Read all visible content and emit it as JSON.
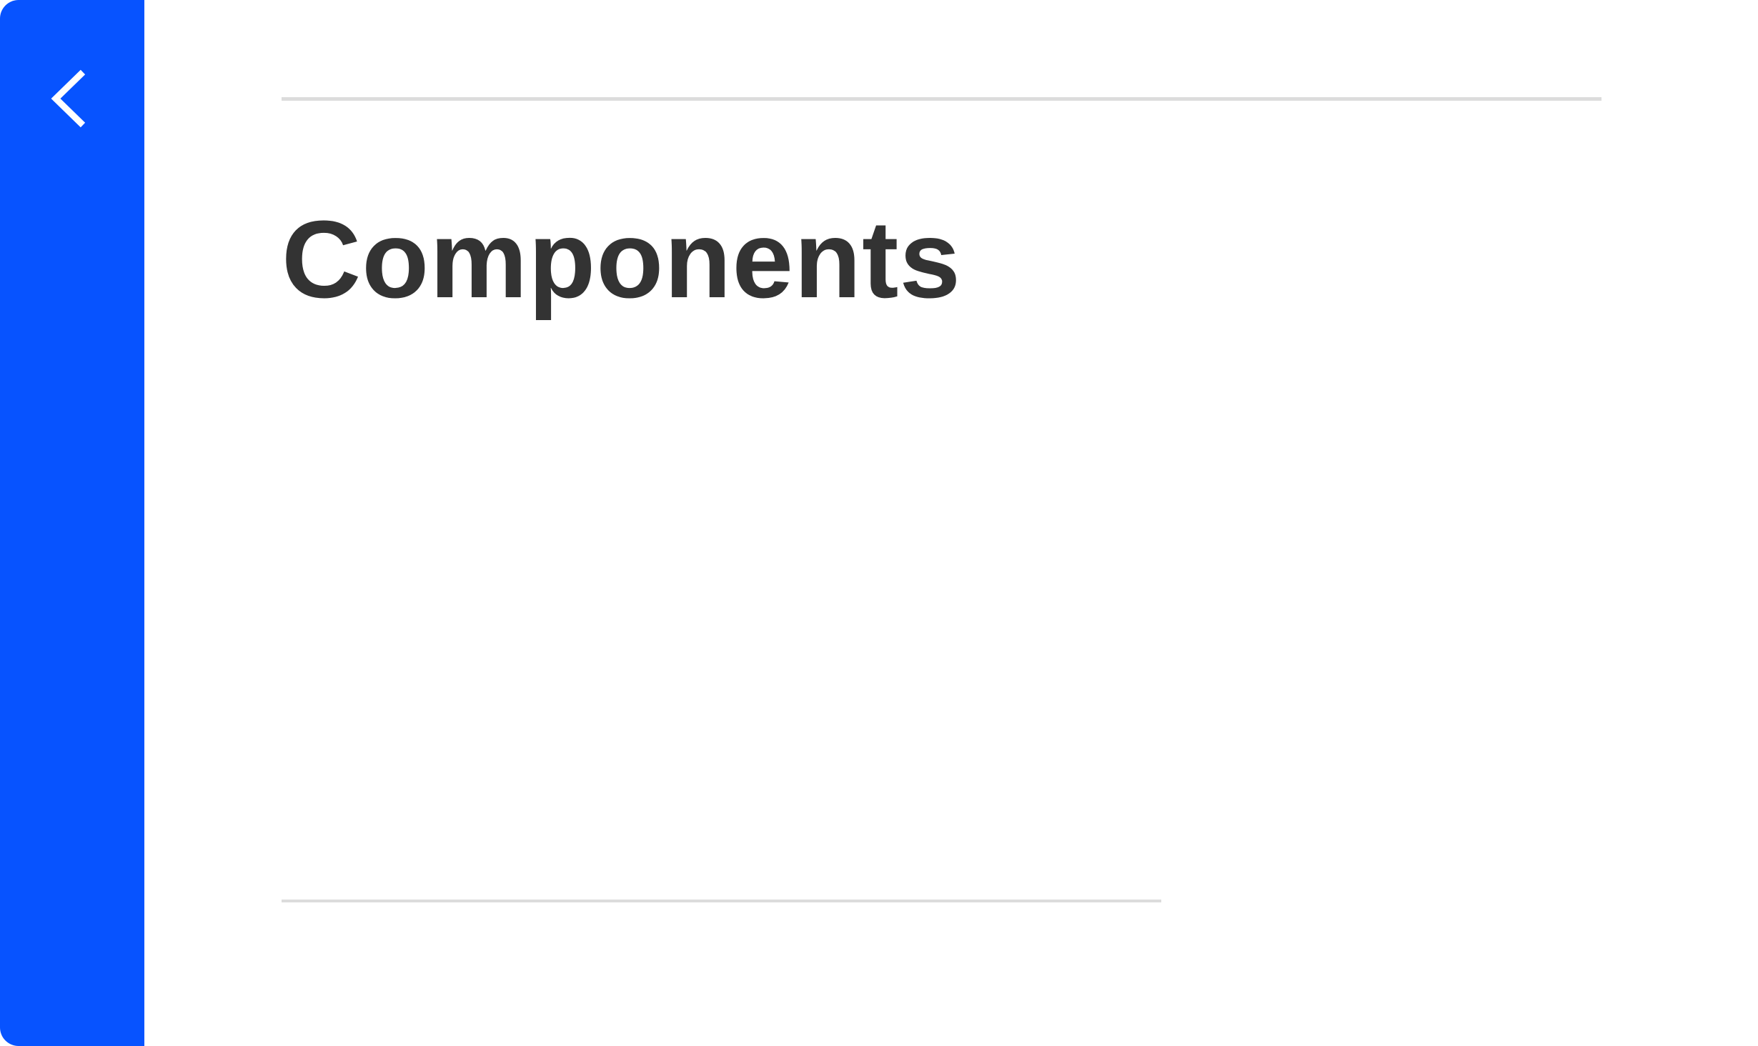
{
  "sidebar": {
    "color": "#0753ff",
    "back_icon": "chevron-left-icon"
  },
  "main": {
    "title": "Components",
    "title_color": "#333333",
    "rule_color": "#dcdcdc"
  }
}
